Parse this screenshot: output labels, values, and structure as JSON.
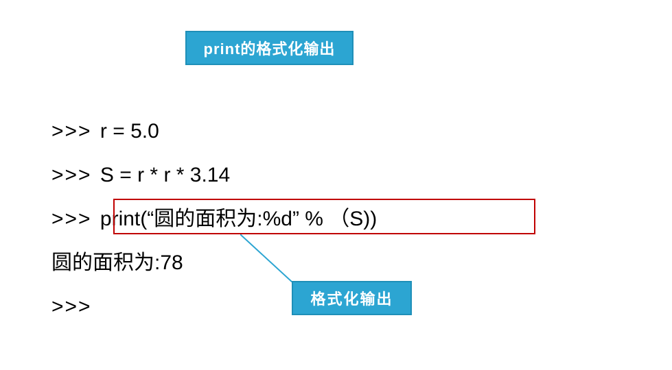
{
  "title": "print的格式化输出",
  "code": {
    "line1_prompt": ">>>",
    "line1_code": "r = 5.0",
    "line2_prompt": ">>>",
    "line2_code": "S = r * r * 3.14",
    "line3_prompt": ">>>",
    "line3_code": "print(“圆的面积为:%d”  % （S))",
    "line4_output": "圆的面积为:78",
    "line5_prompt": ">>>"
  },
  "label": "格式化输出"
}
